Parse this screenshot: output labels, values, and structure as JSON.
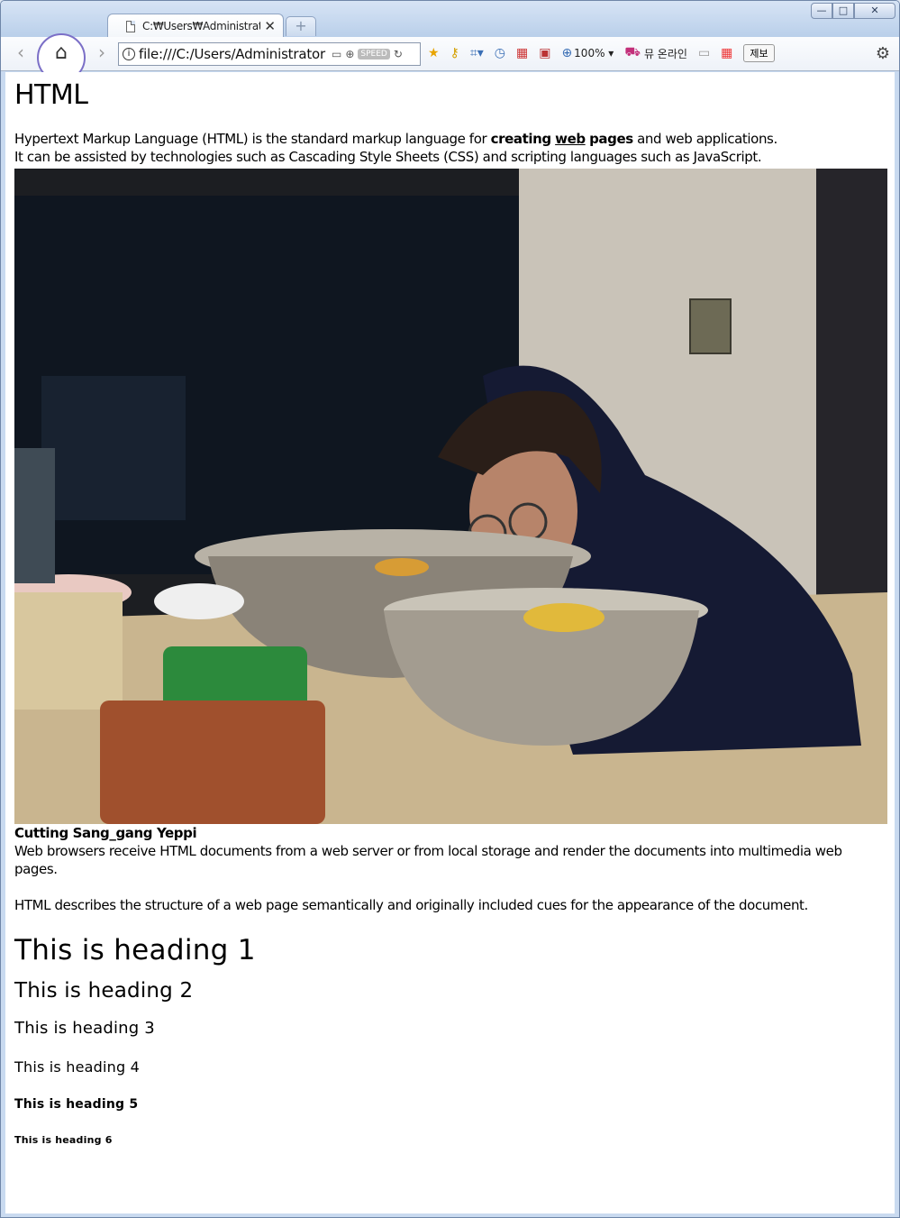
{
  "browser": {
    "tab_title": "C:₩Users₩Administrato",
    "tab_close": "✕",
    "new_tab": "+",
    "window_buttons": {
      "minimize": "—",
      "maximize": "□",
      "close": "✕"
    },
    "back": "‹",
    "forward": "›",
    "home_icon": "⌂",
    "address": "file:///C:/Users/Administrator",
    "speed_badge": "SPEED",
    "zoom": "100% ▾",
    "shop_label": "뮤 온라인",
    "report_label": "제보"
  },
  "page": {
    "title": "HTML",
    "intro": {
      "line1_pre": "Hypertext Markup Language (HTML) is the standard markup language for ",
      "bold1": "creating",
      "bold_underline": "web",
      "bold2": "pages",
      "line1_post": " and web applications.",
      "line2": "It can be assisted by technologies such as Cascading Style Sheets (CSS) and scripting languages such as JavaScript."
    },
    "caption": "Cutting Sang_gang Yeppi",
    "para1": "Web browsers receive HTML documents from a web server or from local storage and render the documents into multimedia web pages.",
    "para2": "HTML describes the structure of a web page semantically and originally included cues for the appearance of the document.",
    "headings": {
      "h1": "This is heading 1",
      "h2": "This is heading 2",
      "h3": "This is heading 3",
      "h4": "This is heading 4",
      "h5": "This is heading 5",
      "h6": "This is heading 6"
    }
  }
}
